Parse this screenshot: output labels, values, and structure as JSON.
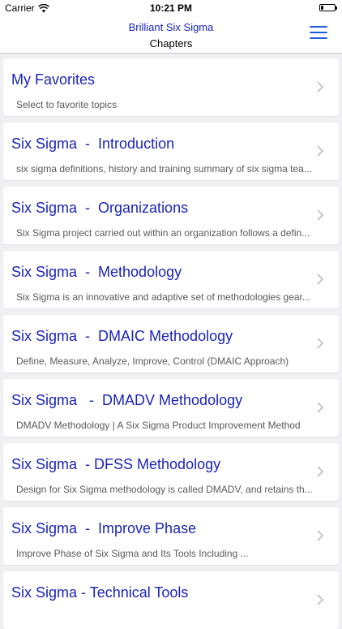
{
  "status_bar": {
    "carrier": "Carrier",
    "time": "10:21 PM"
  },
  "nav": {
    "title": "Brilliant Six Sigma",
    "subtitle": "Chapters",
    "menu_icon": "hamburger-menu-icon",
    "accent_color": "#1b24b8"
  },
  "chapters": [
    {
      "title": "My Favorites",
      "subtitle": "Select to favorite topics"
    },
    {
      "title": "Six Sigma  -  Introduction",
      "subtitle": "six sigma definitions, history and training summary of six sigma tea..."
    },
    {
      "title": "Six Sigma  -  Organizations",
      "subtitle": "Six Sigma project carried out within an organization follows a defin..."
    },
    {
      "title": "Six Sigma  -  Methodology",
      "subtitle": "Six Sigma is an innovative and adaptive set of methodologies gear..."
    },
    {
      "title": "Six Sigma  -  DMAIC Methodology",
      "subtitle": "Define, Measure, Analyze, Improve, Control (DMAIC Approach)"
    },
    {
      "title": "Six Sigma   -  DMADV Methodology",
      "subtitle": "DMADV Methodology | A Six Sigma Product Improvement Method"
    },
    {
      "title": "Six Sigma  - DFSS Methodology",
      "subtitle": "Design for Six Sigma methodology is called DMADV, and retains th..."
    },
    {
      "title": "Six Sigma  -  Improve Phase",
      "subtitle": "Improve Phase of Six Sigma and Its Tools Including ..."
    },
    {
      "title": "Six Sigma - Technical Tools",
      "subtitle": ""
    }
  ]
}
